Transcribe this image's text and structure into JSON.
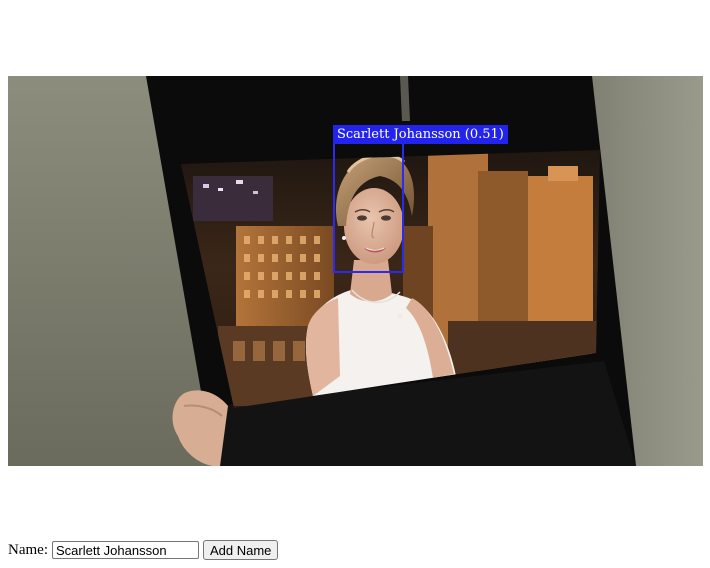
{
  "detection": {
    "name": "Scarlett Johansson",
    "confidence": "0.51",
    "label": "Scarlett Johansson (0.51)",
    "box_color": "#2a2af0"
  },
  "form": {
    "name_label": "Name:",
    "name_value": "Scarlett Johansson",
    "add_button_label": "Add Name"
  }
}
